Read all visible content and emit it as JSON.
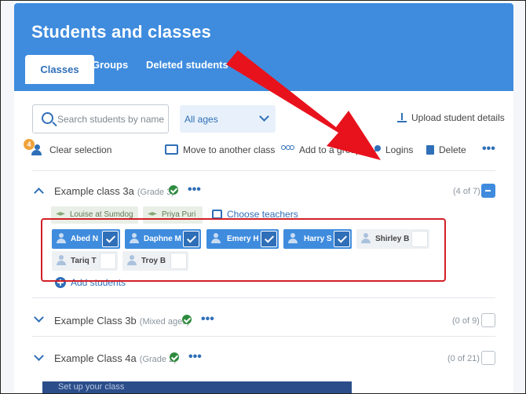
{
  "header": {
    "title": "Students and classes",
    "tabs": [
      {
        "label": "Classes",
        "active": true
      },
      {
        "label": "Groups",
        "active": false
      },
      {
        "label": "Deleted students",
        "active": false
      }
    ]
  },
  "filters": {
    "search_placeholder": "Search students by name",
    "age_select": "All ages",
    "upload_label": "Upload student details"
  },
  "toolbar": {
    "selection_count": "4",
    "clear_selection": "Clear selection",
    "move": "Move to another class",
    "add_group": "Add to a group",
    "logins": "Logins",
    "delete": "Delete",
    "more": "•••"
  },
  "classes": [
    {
      "name": "Example class 3a",
      "grade": "(Grade 3)",
      "count": "(4 of 7)",
      "expanded": true,
      "teachers": [
        "Louise at Sumdog",
        "Priya Puri"
      ],
      "choose_teachers": "Choose teachers",
      "students": [
        {
          "name": "Abed N",
          "selected": true
        },
        {
          "name": "Daphne M",
          "selected": true
        },
        {
          "name": "Emery H",
          "selected": true
        },
        {
          "name": "Harry S",
          "selected": true
        },
        {
          "name": "Shirley B",
          "selected": false
        },
        {
          "name": "Tariq T",
          "selected": false
        },
        {
          "name": "Troy B",
          "selected": false
        }
      ],
      "add_students": "Add students"
    },
    {
      "name": "Example Class 3b",
      "grade": "(Mixed ages)",
      "count": "(0 of 9)",
      "expanded": false
    },
    {
      "name": "Example Class 4a",
      "grade": "(Grade 2)",
      "count": "(0 of 21)",
      "expanded": false
    }
  ],
  "footer": {
    "setup_label": "Set up your class"
  },
  "colors": {
    "primary": "#3f8cde",
    "annotation_red": "#e8121d",
    "success": "#2e8b3e",
    "badge": "#f0a23a"
  }
}
